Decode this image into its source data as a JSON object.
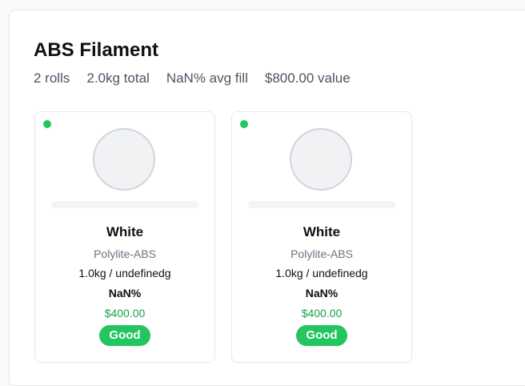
{
  "group": {
    "title": "ABS Filament",
    "stats": {
      "rolls": "2 rolls",
      "total": "2.0kg total",
      "avg_fill": "NaN% avg fill",
      "value": "$800.00 value"
    }
  },
  "colors": {
    "status_good": "#22c55e",
    "price": "#16a34a"
  },
  "cards": [
    {
      "color_name": "White",
      "material": "Polylite-ABS",
      "weight": "1.0kg / undefinedg",
      "percent": "NaN%",
      "price": "$400.00",
      "status": "Good",
      "fill_fraction": 0
    },
    {
      "color_name": "White",
      "material": "Polylite-ABS",
      "weight": "1.0kg / undefinedg",
      "percent": "NaN%",
      "price": "$400.00",
      "status": "Good",
      "fill_fraction": 0
    }
  ]
}
